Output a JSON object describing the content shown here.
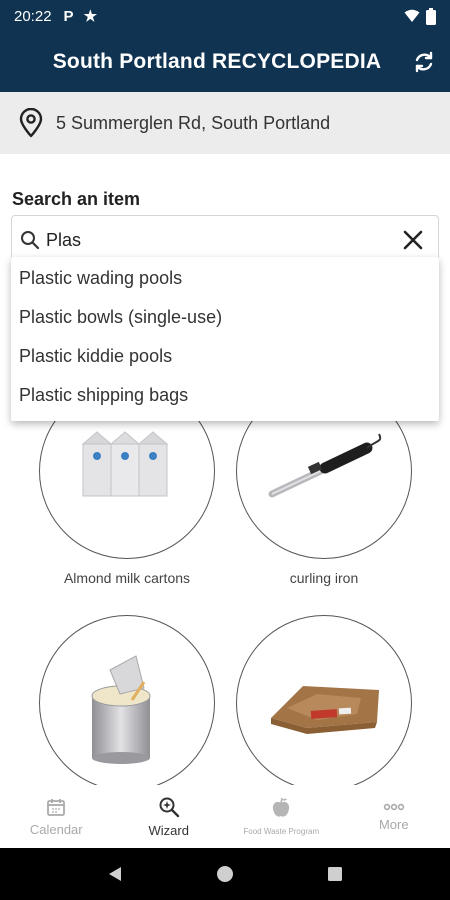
{
  "status_bar": {
    "time": "20:22",
    "icons": [
      "parking-app-icon",
      "star-icon",
      "wifi-icon",
      "battery-icon"
    ],
    "p_glyph": "P",
    "star_glyph": "★"
  },
  "app_bar": {
    "title": "South Portland RECYCLOPEDIA",
    "background": "#0f3350"
  },
  "location": {
    "address": "5 Summerglen Rd, South Portland"
  },
  "search": {
    "label": "Search an item",
    "value": "Plas"
  },
  "suggestions": [
    "Plastic wading pools",
    "Plastic bowls (single-use)",
    "Plastic kiddie pools",
    "Plastic shipping bags"
  ],
  "items": [
    {
      "label": "Almond milk cartons"
    },
    {
      "label": "curling iron"
    },
    {
      "label": ""
    },
    {
      "label": ""
    }
  ],
  "bottom_nav": [
    {
      "label": "Calendar",
      "icon": "calendar-icon",
      "active": false
    },
    {
      "label": "Wizard",
      "icon": "wizard-search-icon",
      "active": true
    },
    {
      "label": "Food Waste Program",
      "icon": "apple-icon",
      "active": false
    },
    {
      "label": "More",
      "icon": "more-icon",
      "active": false
    }
  ]
}
